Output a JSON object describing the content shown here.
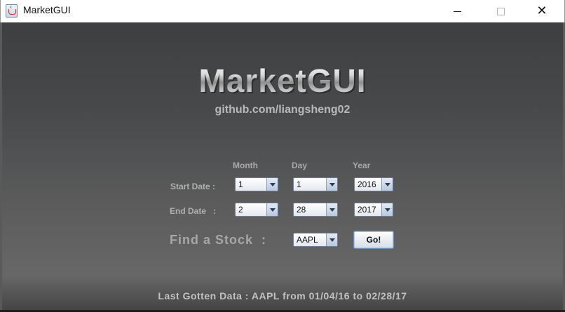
{
  "window": {
    "title": "MarketGUI"
  },
  "header": {
    "logo": "MarketGUI",
    "subtitle": "github.com/liangsheng02"
  },
  "columns": {
    "month": "Month",
    "day": "Day",
    "year": "Year"
  },
  "start_date": {
    "label": "Start Date :",
    "month": "1",
    "day": "1",
    "year": "2016"
  },
  "end_date": {
    "label": "End Date   :",
    "month": "2",
    "day": "28",
    "year": "2017"
  },
  "find_stock": {
    "label": "Find a Stock  :",
    "symbol": "AAPL",
    "go_label": "Go!"
  },
  "status": {
    "text": "Last Gotten Data : AAPL from 01/04/16 to 02/28/17"
  },
  "colors": {
    "background_top": "#3d3f41",
    "background_bottom": "#676767",
    "label_text": "#b0b0b0",
    "combo_border": "#6f7e95"
  }
}
